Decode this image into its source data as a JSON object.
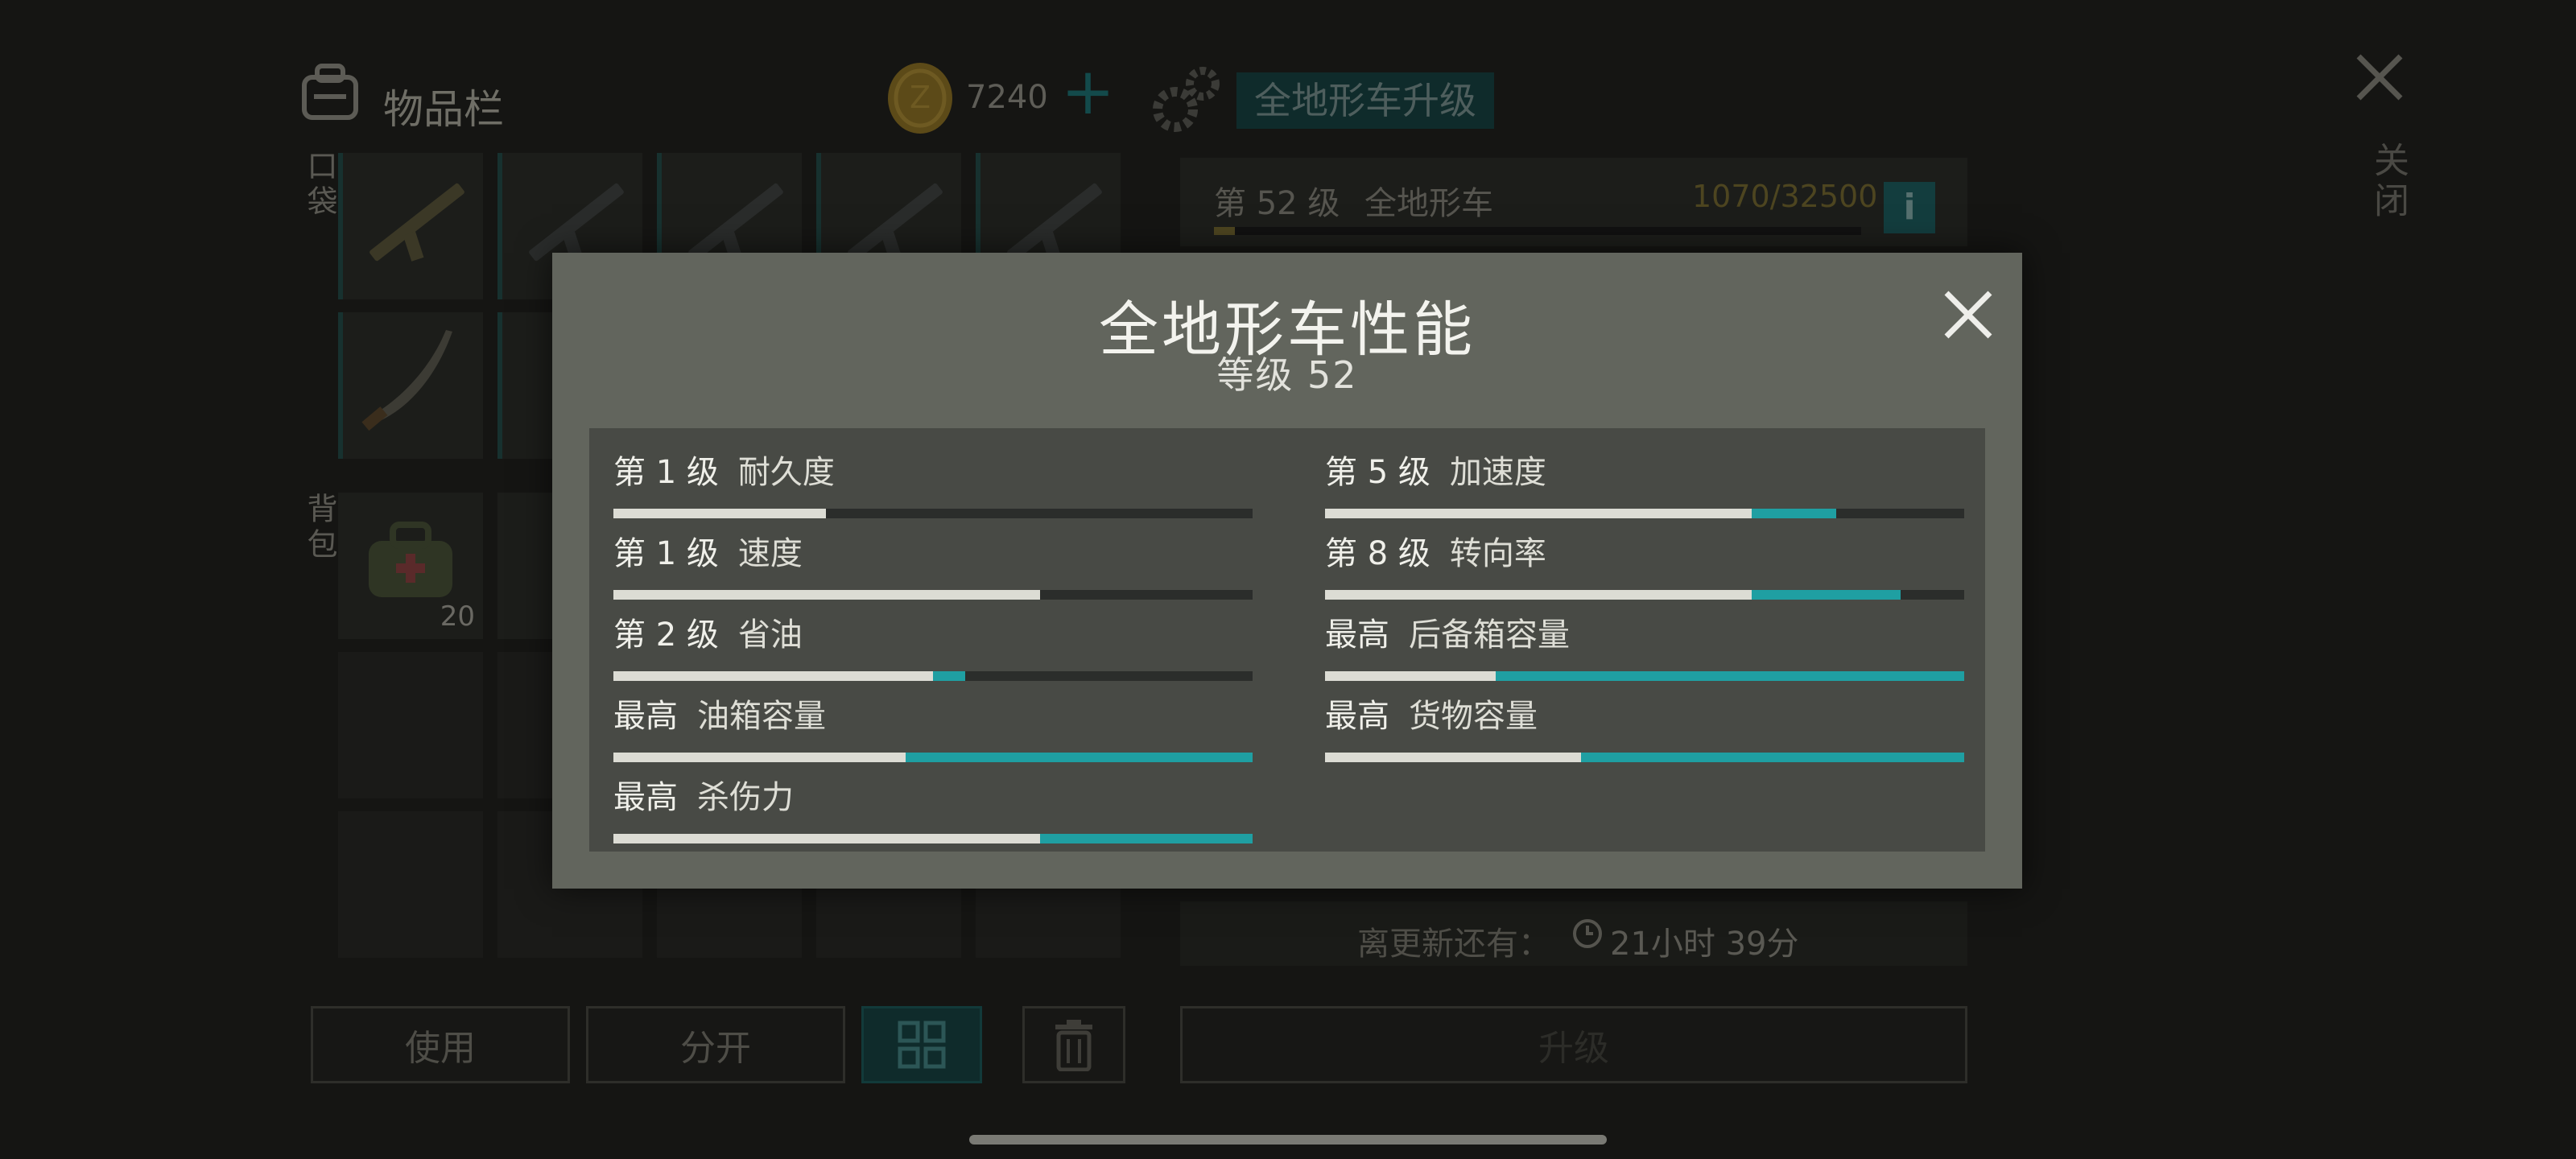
{
  "inventory": {
    "title": "物品栏",
    "pocket_label": "口袋",
    "backpack_label": "背包",
    "stack_count": "20"
  },
  "currency": {
    "amount": "7240",
    "plus": "+"
  },
  "upgrade_panel": {
    "tab_label": "全地形车升级",
    "level_prefix": "第 52 级",
    "vehicle_name": "全地形车",
    "progress_text": "1070/32500",
    "progress": {
      "current": 1070,
      "max": 32500
    },
    "info_label": "i",
    "refresh_label": "离更新还有：",
    "refresh_time": "21小时 39分",
    "upgrade_button": "升级"
  },
  "top_close_label": "关闭",
  "buttons": {
    "use": "使用",
    "split": "分开"
  },
  "modal": {
    "title": "全地形车性能",
    "subtitle": "等级 52",
    "stats": [
      {
        "level": "第 1 级",
        "name": "耐久度",
        "base": 0.333,
        "bonus": 0.0
      },
      {
        "level": "第 5 级",
        "name": "加速度",
        "base": 0.667,
        "bonus": 0.133
      },
      {
        "level": "第 1 级",
        "name": "速度",
        "base": 0.667,
        "bonus": 0.0
      },
      {
        "level": "第 8 级",
        "name": "转向率",
        "base": 0.667,
        "bonus": 0.233
      },
      {
        "level": "第 2 级",
        "name": "省油",
        "base": 0.5,
        "bonus": 0.05
      },
      {
        "level": "最高",
        "name": "后备箱容量",
        "base": 0.267,
        "bonus": 0.733
      },
      {
        "level": "最高",
        "name": "油箱容量",
        "base": 0.457,
        "bonus": 0.543
      },
      {
        "level": "最高",
        "name": "货物容量",
        "base": 0.4,
        "bonus": 0.6
      },
      {
        "level": "最高",
        "name": "杀伤力",
        "base": 0.667,
        "bonus": 0.333
      }
    ]
  },
  "colors": {
    "accent": "#1f9fa2",
    "gold": "#c9a227",
    "modal_bg": "#62655d",
    "panel_bg": "#484a45"
  }
}
